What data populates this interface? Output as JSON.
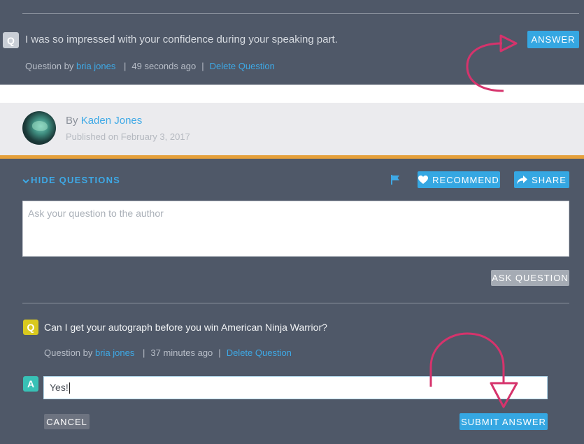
{
  "top_question": {
    "badge": "Q",
    "text": "I was so impressed with your confidence during your speaking part.",
    "meta_prefix": "Question by",
    "author": "bria jones",
    "sep1": "|",
    "time": "49 seconds ago",
    "sep2": "|",
    "delete_label": "Delete Question",
    "answer_label": "ANSWER"
  },
  "author_bar": {
    "by": "By",
    "name": "Kaden Jones",
    "published": "Published on February 3, 2017"
  },
  "toolbar": {
    "hide_questions": "HIDE QUESTIONS",
    "recommend": "RECOMMEND",
    "share": "SHARE"
  },
  "ask": {
    "placeholder": "Ask your question to the author",
    "ask_button": "ASK QUESTION"
  },
  "second_question": {
    "badge": "Q",
    "text": "Can I get your autograph before you win American Ninja Warrior?",
    "meta_prefix": "Question by",
    "author": "bria jones",
    "sep1": "|",
    "time": "37 minutes ago",
    "sep2": "|",
    "delete_label": "Delete Question"
  },
  "answer_form": {
    "badge": "A",
    "value": "Yes!",
    "cancel": "CANCEL",
    "submit": "SUBMIT ANSWER"
  },
  "colors": {
    "background": "#4f5868",
    "accent_blue": "#35a7e2",
    "orange": "#e5a03b",
    "annotation_pink": "#d6336c",
    "badge_yellow": "#d9c91e",
    "badge_teal": "#38c1b6"
  },
  "icons": {
    "chevron": "chevron-down-icon",
    "flag": "flag-icon",
    "heart": "heart-icon",
    "share": "share-arrow-icon"
  }
}
